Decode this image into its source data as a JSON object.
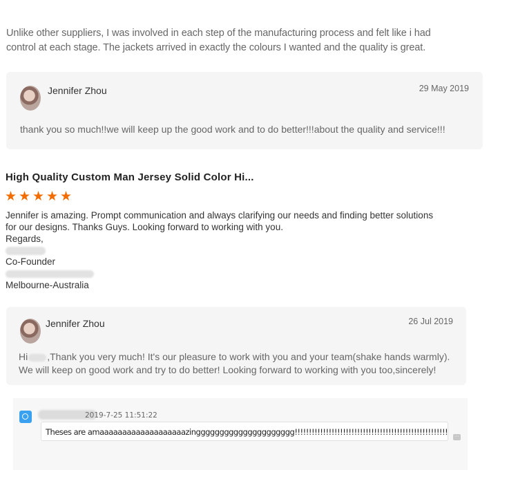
{
  "review1": {
    "text": "Unlike other suppliers, I was involved in each step of the manufacturing process and felt like i had control at each stage. The jackets arrived in exactly the colours I wanted and the quality is great."
  },
  "reply1": {
    "name": "Jennifer Zhou",
    "date": "29 May 2019",
    "message": "thank you so much!!we will keep up the good work and to do better!!!about the quality and service!!!"
  },
  "review2": {
    "product_title": "High Quality Custom Man Jersey Solid Color Hi...",
    "stars": 5,
    "line1": "Jennifer is amazing. Prompt communication and always clarifying our needs and finding better solutions for our designs. Thanks Guys. Looking forward to working with you.",
    "line_regards": "Regards,",
    "line_cofounder": "Co-Founder",
    "line_location": "Melbourne-Australia"
  },
  "reply2": {
    "name": "Jennifer Zhou",
    "date": "26 Jul 2019",
    "message_prefix": "Hi",
    "message": ",Thank you very much! It's our pleasure to work with you and your team(shake hands warmly). We will keep on good work and try to do better! Looking forward to working with you too,sincerely!"
  },
  "chat": {
    "timestamp": "2019-7-25 11:51:22",
    "message": "Theses are amaaaaaaaaaaaaaaaaaaazinggggggggggggggggggggg!!!!!!!!!!!!!!!!!!!!!!!!!!!!!!!!!!!!!!!!!!!!!!!!!!!!!!!!!!!!!!!!!!!!!!!!"
  },
  "colors": {
    "star": "#f26c00",
    "reply_bg": "#f5f5f5",
    "chat_icon": "#3aa0f0"
  }
}
